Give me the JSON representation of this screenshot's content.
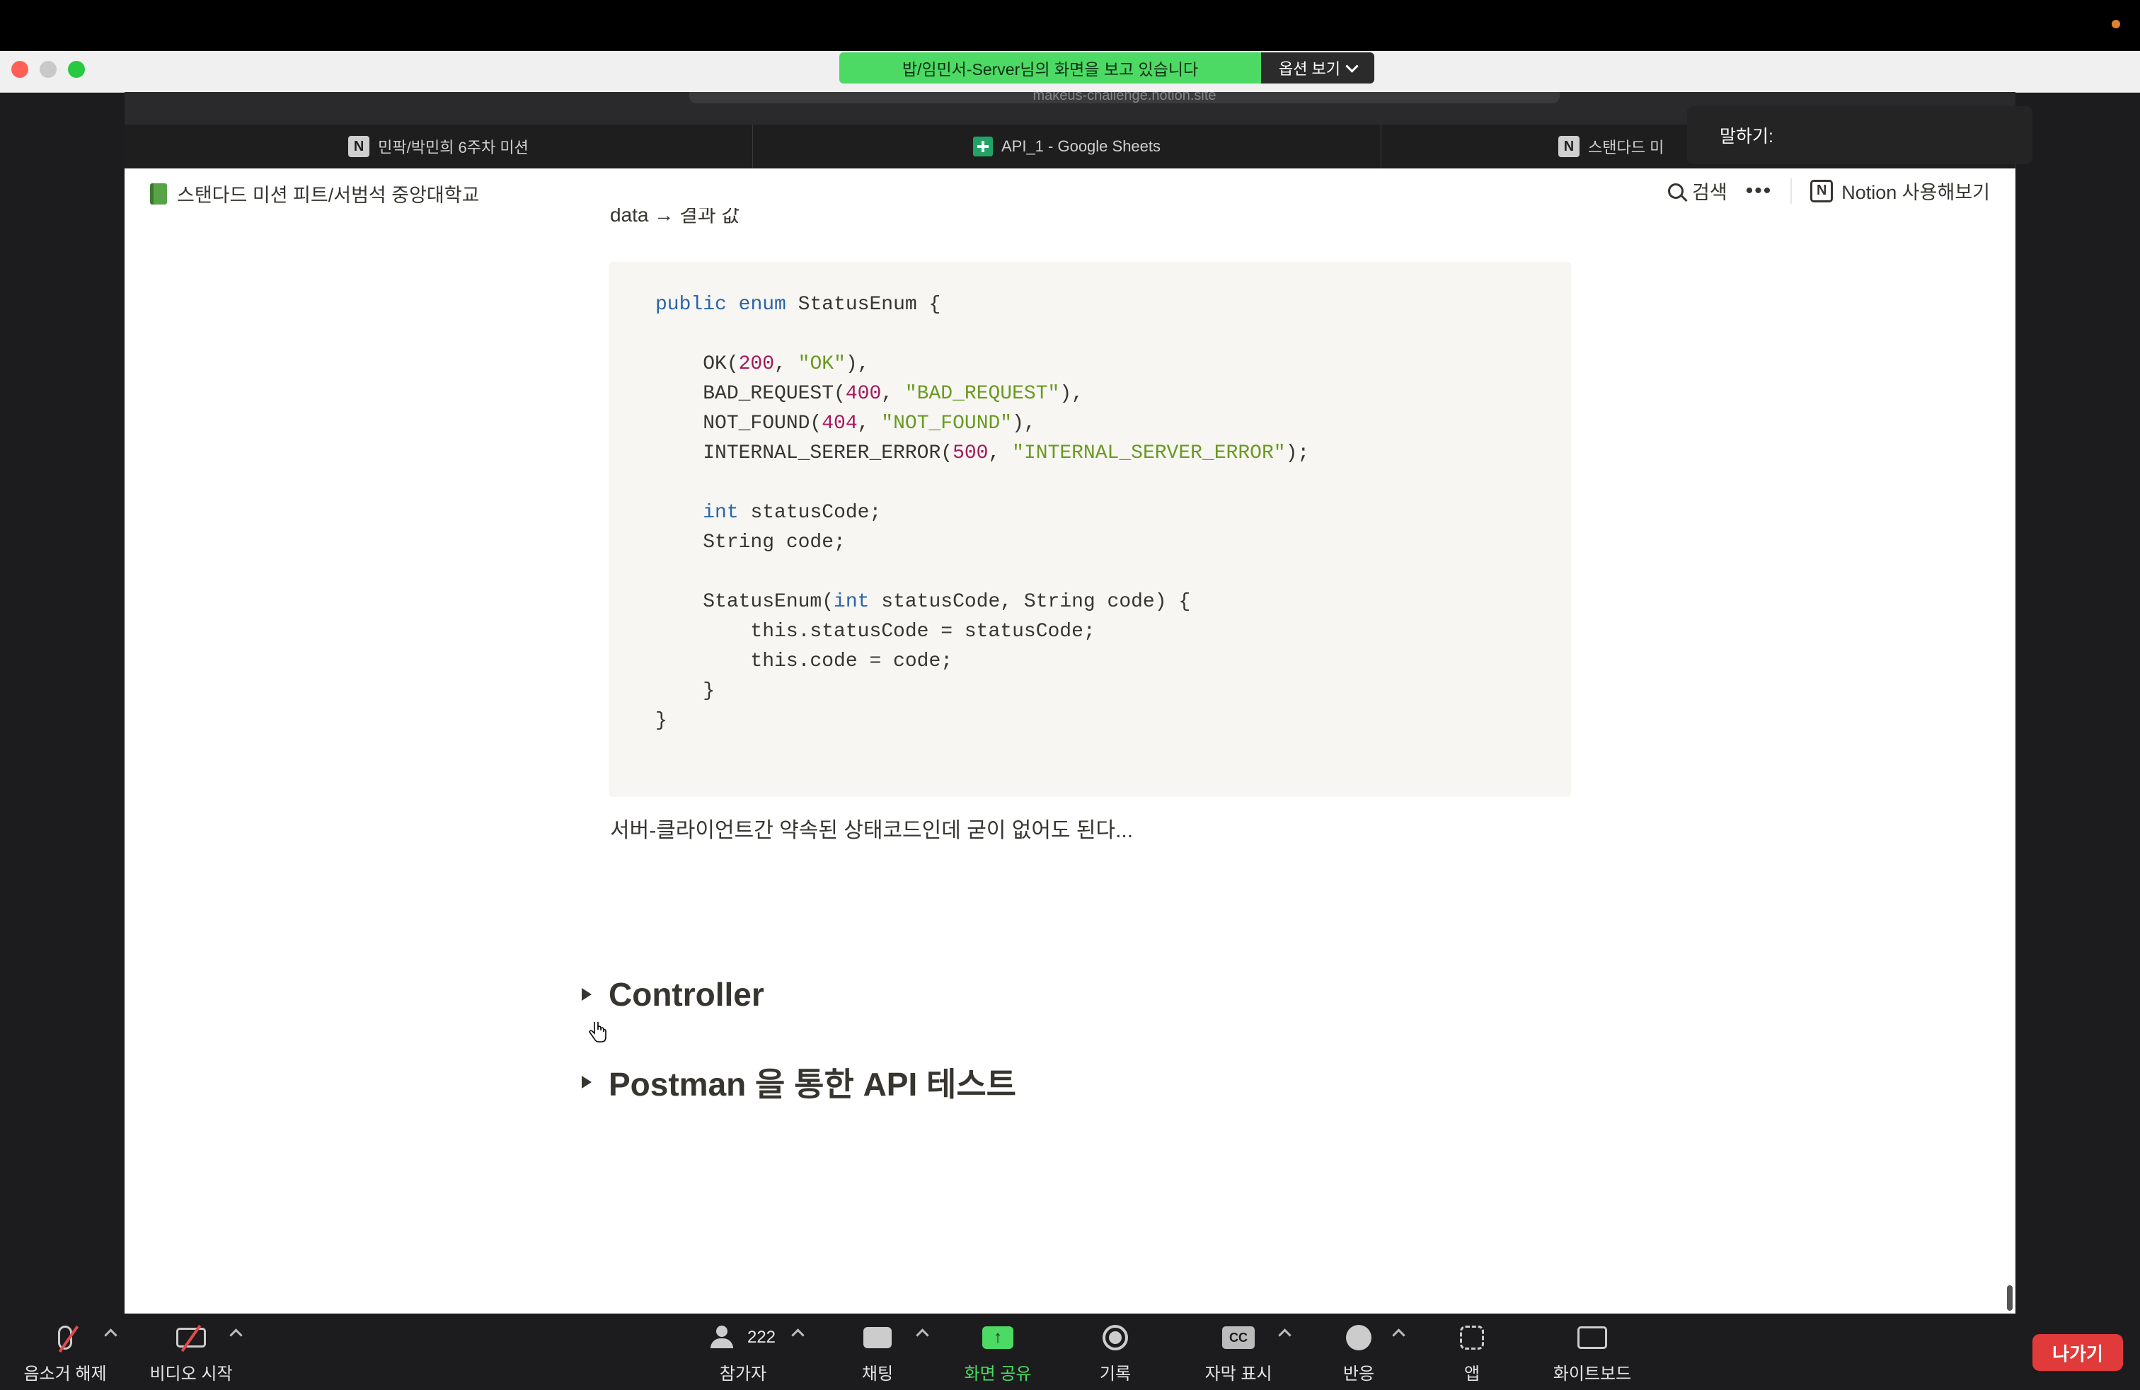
{
  "zoom": {
    "share_banner": "밥/임민서-Server님의 화면을 보고 있습니다",
    "options_label": "옵션 보기",
    "speak_label": "말하기:",
    "colors": {
      "banner": "#4cd964",
      "leave": "#e03a3a"
    }
  },
  "browser": {
    "url": "makeus-challenge.notion.site",
    "tabs": [
      {
        "label": "민팍/박민희 6주차 미션",
        "icon": "notion-icon"
      },
      {
        "label": "API_1 - Google Sheets",
        "icon": "sheets-icon"
      },
      {
        "label": "스탠다드 미",
        "icon": "notion-icon"
      }
    ]
  },
  "notion": {
    "breadcrumb": "스탠다드 미션 피트/서범석 중앙대학교",
    "search_label": "검색",
    "more_label": "•••",
    "try_notion_label": "Notion 사용해보기",
    "cut_text": "data → 결과 값",
    "code_lines": [
      "public enum StatusEnum {",
      "",
      "    OK(200, \"OK\"),",
      "    BAD_REQUEST(400, \"BAD_REQUEST\"),",
      "    NOT_FOUND(404, \"NOT_FOUND\"),",
      "    INTERNAL_SERER_ERROR(500, \"INTERNAL_SERVER_ERROR\");",
      "",
      "    int statusCode;",
      "    String code;",
      "",
      "    StatusEnum(int statusCode, String code) {",
      "        this.statusCode = statusCode;",
      "        this.code = code;",
      "    }",
      "}"
    ],
    "paragraph": "서버-클라이언트간 약속된 상태코드인데 굳이 없어도 된다...",
    "toggles": [
      {
        "label": "Controller"
      },
      {
        "label": "Postman 을 통한 API 테스트"
      }
    ]
  },
  "toolbar": {
    "unmute": "음소거 해제",
    "start_video": "비디오 시작",
    "participants_count": "222",
    "participants": "참가자",
    "chat": "채팅",
    "share_screen": "화면 공유",
    "record": "기록",
    "captions": "자막 표시",
    "cc": "CC",
    "reactions": "반응",
    "apps": "앱",
    "whiteboard": "화이트보드",
    "leave": "나가기"
  }
}
